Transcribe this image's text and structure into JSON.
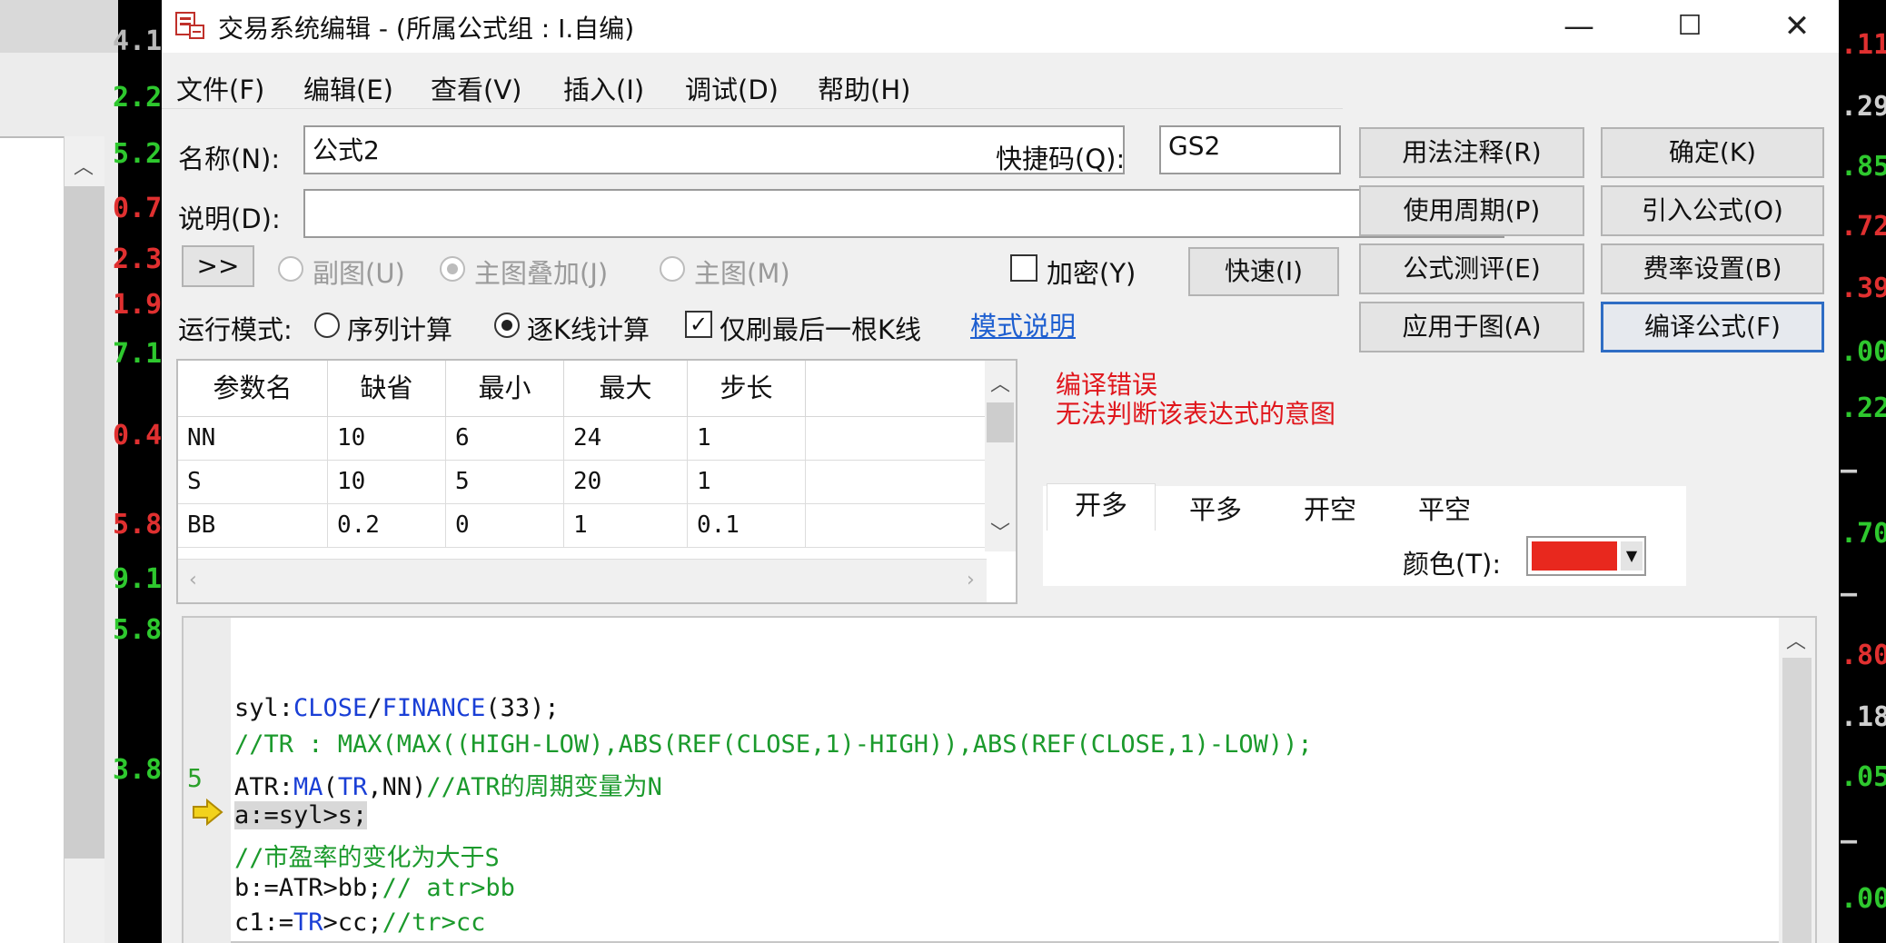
{
  "background": {
    "left_numbers": [
      {
        "text": "4.1",
        "color": "#b9b9b9"
      },
      {
        "text": "2.2",
        "color": "#2ec82e"
      },
      {
        "text": "5.2",
        "color": "#2ec82e"
      },
      {
        "text": "0.7",
        "color": "#e03030"
      },
      {
        "text": "2.3",
        "color": "#e03030"
      },
      {
        "text": "1.9",
        "color": "#e03030"
      },
      {
        "text": "7.1",
        "color": "#2ec82e"
      },
      {
        "text": "0.4",
        "color": "#e03030"
      },
      {
        "text": "5.8",
        "color": "#e03030"
      },
      {
        "text": "9.1",
        "color": "#2ec82e"
      },
      {
        "text": "5.8",
        "color": "#2ec82e"
      },
      {
        "text": "3.8",
        "color": "#2ec82e"
      }
    ],
    "right_numbers": [
      {
        "text": ".11",
        "color": "#e03030"
      },
      {
        "text": ".29",
        "color": "#cfcfcf"
      },
      {
        "text": ".85",
        "color": "#2ec82e"
      },
      {
        "text": ".72",
        "color": "#e03030"
      },
      {
        "text": ".39",
        "color": "#e03030"
      },
      {
        "text": ".00",
        "color": "#2ec82e"
      },
      {
        "text": ".22",
        "color": "#2ec82e"
      },
      {
        "text": "—",
        "color": "#cfcfcf"
      },
      {
        "text": ".70",
        "color": "#2ec82e"
      },
      {
        "text": "—",
        "color": "#cfcfcf"
      },
      {
        "text": ".80",
        "color": "#e03030"
      },
      {
        "text": ".18",
        "color": "#cfcfcf"
      },
      {
        "text": ".05",
        "color": "#2ec82e"
      },
      {
        "text": "—",
        "color": "#cfcfcf"
      },
      {
        "text": ".00",
        "color": "#2ec82e"
      }
    ]
  },
  "window": {
    "title": "交易系统编辑 - (所属公式组 : I.自编)",
    "minimize": "—",
    "maximize": "☐",
    "close": "✕"
  },
  "menu": [
    "文件(F)",
    "编辑(E)",
    "查看(V)",
    "插入(I)",
    "调试(D)",
    "帮助(H)"
  ],
  "form": {
    "name_label": "名称(N):",
    "name_value": "公式2",
    "shortcut_label": "快捷码(Q):",
    "shortcut_value": "GS2",
    "desc_label": "说明(D):",
    "desc_value": "",
    "expand_button": ">>",
    "radio_sub": "副图(U)",
    "radio_overlay": "主图叠加(J)",
    "radio_main": "主图(M)",
    "encrypt_label": "加密(Y)",
    "fast_button": "快速(I)",
    "run_mode_label": "运行模式:",
    "run_seq": "序列计算",
    "run_bar": "逐K线计算",
    "refresh_last": "仅刷最后一根K线",
    "mode_link": "模式说明"
  },
  "buttons": {
    "usage": "用法注释(R)",
    "ok": "确定(K)",
    "period": "使用周期(P)",
    "import": "引入公式(O)",
    "evaluate": "公式测评(E)",
    "fee": "费率设置(B)",
    "apply": "应用于图(A)",
    "compile": "编译公式(F)"
  },
  "params": {
    "headers": [
      "参数名",
      "缺省",
      "最小",
      "最大",
      "步长"
    ],
    "rows": [
      [
        "NN",
        "10",
        "6",
        "24",
        "1"
      ],
      [
        "S",
        "10",
        "5",
        "20",
        "1"
      ],
      [
        "BB",
        "0.2",
        "0",
        "1",
        "0.1"
      ]
    ]
  },
  "error": {
    "title": "编译错误",
    "message": "无法判断该表达式的意图"
  },
  "signal_tabs": [
    "开多",
    "平多",
    "开空",
    "平空"
  ],
  "color_label": "颜色(T):",
  "color_value": "#e8281e",
  "editor": {
    "line_number": "5",
    "arrow_icon": "pointer-arrow-icon",
    "lines": [
      {
        "a": "syl:",
        "k": "CLOSE",
        "b": "/",
        "k2": "FINANCE",
        "c": "(33);"
      },
      {
        "comment": "//TR : MAX(MAX((HIGH-LOW),ABS(REF(CLOSE,1)-HIGH)),ABS(REF(CLOSE,1)-LOW));"
      },
      {
        "a": "ATR:",
        "k": "MA",
        "b": "(",
        "k2": "TR",
        "c": ",NN)",
        "comment": "//ATR的周期变量为N"
      },
      {
        "a": "a:=syl>s;"
      },
      {
        "comment": "//市盈率的变化为大于S"
      },
      {
        "a": "b:=ATR>bb;",
        "comment": "// atr>bb"
      },
      {
        "a": "c1:=",
        "k": "TR",
        "b": ">cc;",
        "comment": "//tr>cc"
      }
    ]
  }
}
